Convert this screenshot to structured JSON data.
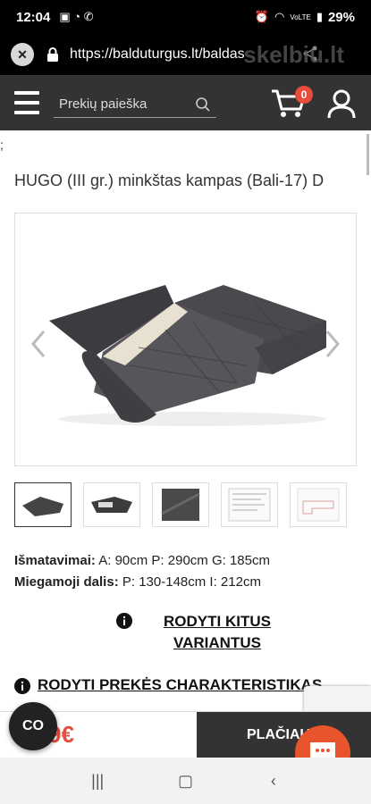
{
  "status_bar": {
    "time": "12:04",
    "battery": "29%",
    "signal_text": "VoLTE"
  },
  "browser": {
    "url": "https://balduturgus.lt/baldas",
    "watermark": "skelbiu.lt"
  },
  "header": {
    "search_placeholder": "Prekių paieška",
    "cart_count": "0"
  },
  "page": {
    "stray_char": ";",
    "product_title": "HUGO (III gr.) minkštas kampas (Bali-17) D",
    "specs": {
      "dimensions_label": "Išmatavimai:",
      "dimensions_value": " A: 90cm P: 290cm G: 185cm",
      "sleeping_label": "Miegamoji dalis:",
      "sleeping_value": " P: 130-148cm I: 212cm"
    },
    "variants_link": "RODYTI KITUS VARIANTUS",
    "characteristics_link": "RODYTI PREKĖS CHARAKTERISTIKAS"
  },
  "bottom": {
    "price": "9€",
    "more_button": "PLAČIAU",
    "co_button": "CO"
  },
  "colors": {
    "header_bg": "#333333",
    "accent": "#e74c3c",
    "chat": "#e8542c"
  }
}
